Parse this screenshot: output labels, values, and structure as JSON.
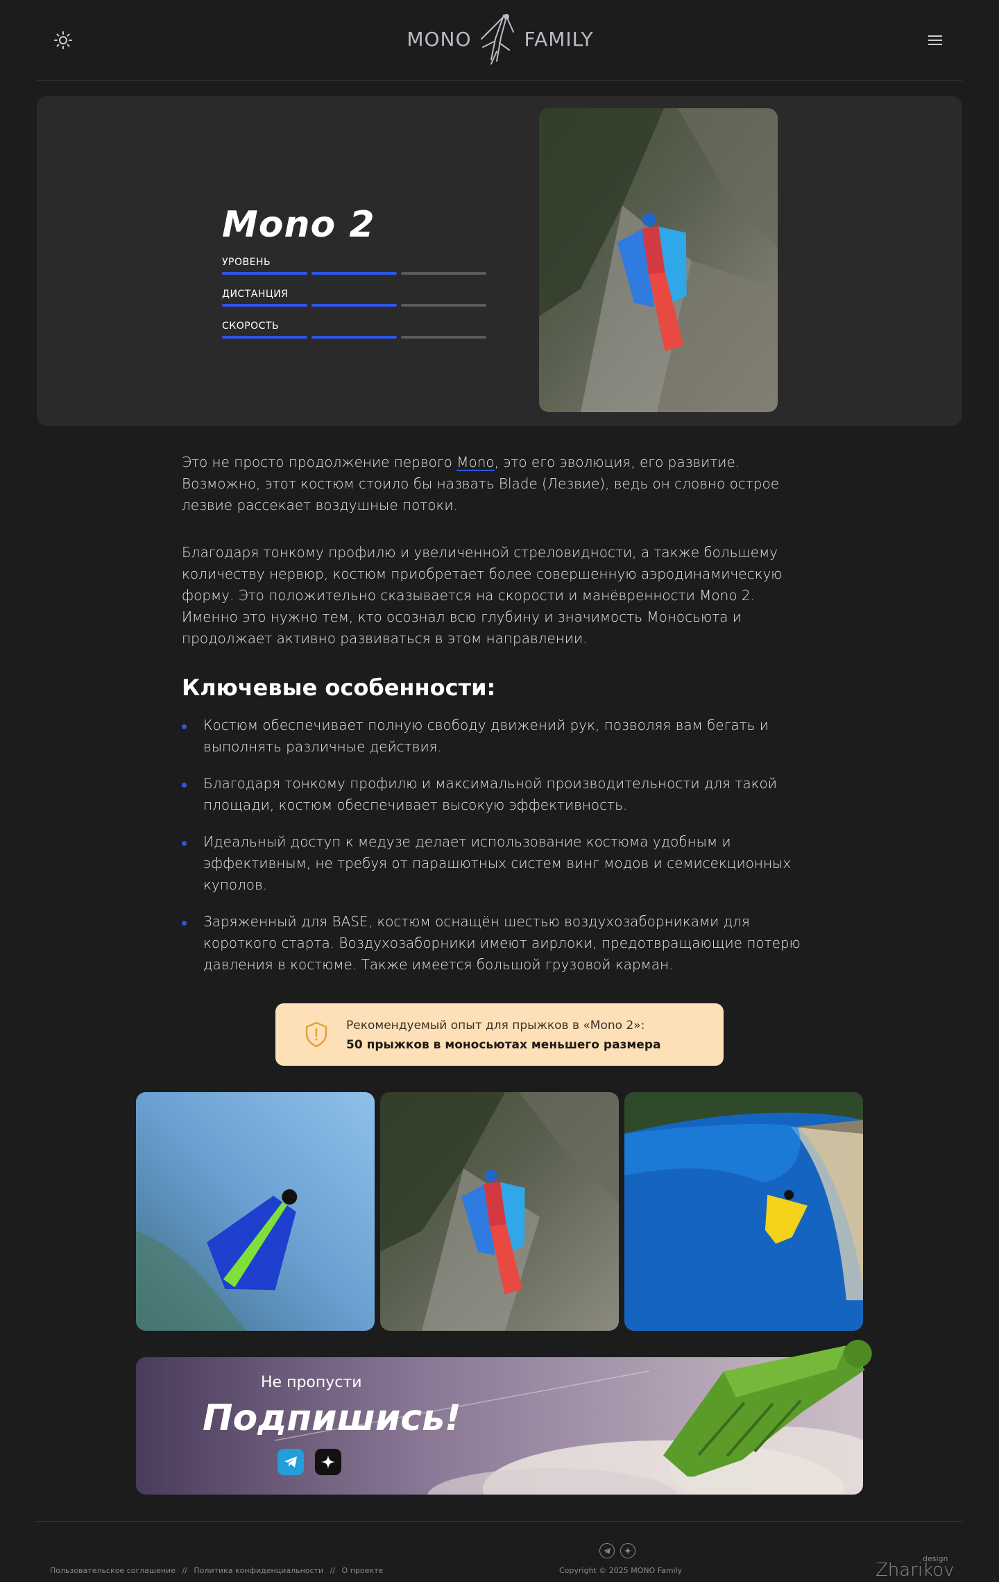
{
  "header": {
    "brand_left": "MONO",
    "brand_right": "FAMILY",
    "theme_icon": "sun-icon",
    "menu_icon": "hamburger-menu-icon"
  },
  "hero": {
    "title": "Mono 2",
    "stats": [
      {
        "label": "УРОВЕНЬ",
        "level": 2,
        "max": 3
      },
      {
        "label": "ДИСТАНЦИЯ",
        "level": 2,
        "max": 3
      },
      {
        "label": "СКОРОСТЬ",
        "level": 2,
        "max": 3
      }
    ]
  },
  "description": {
    "p1_before": "Это не просто продолжение первого ",
    "p1_link": "Mono",
    "p1_after": ", это его эволюция, его развитие. Возможно, этот костюм стоило бы назвать Blade (Лезвие), ведь он словно острое лезвие рассекает воздушные потоки.",
    "p2": "Благодаря тонкому профилю и увеличенной стреловидности, а также большему количеству нервюр, костюм приобретает более совершенную аэродинамическую форму. Это положительно сказывается на скорости и манёвренности Mono 2. Именно это нужно тем, кто осознал всю глубину и значимость Моносьюта и продолжает активно развиваться в этом направлении."
  },
  "features": {
    "heading": "Ключевые особенности:",
    "items": [
      "Костюм обеспечивает полную свободу движений рук, позволяя вам бегать и выполнять различные действия.",
      "Благодаря тонкому профилю и максимальной производительности для такой площади, костюм обеспечивает высокую эффективность.",
      "Идеальный доступ к медузе делает использование костюма удобным и эффективным, не требуя от парашютных систем винг модов и семисекционных куполов.",
      "Заряженный для BASE, костюм оснащён шестью воздухозаборниками для короткого старта. Воздухозаборники имеют аирлоки, предотвращающие потерю давления в костюме. Также имеется большой грузовой карман."
    ]
  },
  "notice": {
    "line1": "Рекомендуемый опыт для прыжков в «Mono 2»:",
    "line2": "50 прыжков в моносьютах меньшего размера",
    "icon": "shield-warning-icon"
  },
  "subscribe": {
    "subtitle": "Не пропусти",
    "title": "Подпишись!",
    "buttons": [
      "telegram-icon",
      "sparkle-icon"
    ]
  },
  "footer": {
    "links": [
      "Пользовательское соглашение",
      "//",
      "Политика конфиденциальности",
      "//",
      "О проекте"
    ],
    "copyright": "Copyright © 2025 MONO Family",
    "credit": "Zharikov",
    "credit_sup": "design"
  },
  "colors": {
    "background": "#1c1c1d",
    "card": "#2a2a2b",
    "accent": "#2f55e6",
    "notice": "#fde0b8"
  }
}
